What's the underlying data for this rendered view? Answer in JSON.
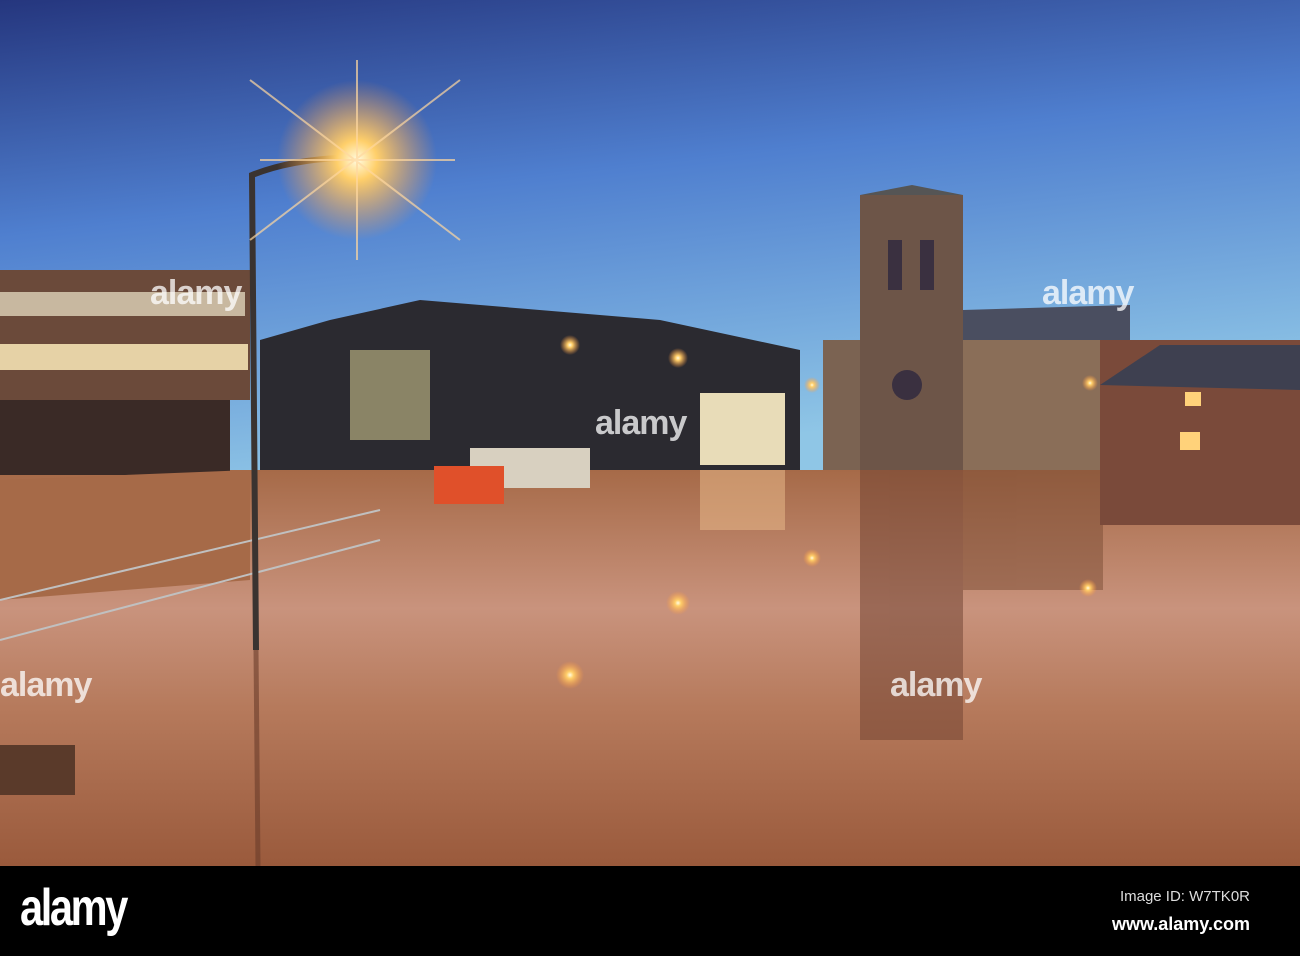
{
  "watermark": {
    "text": "alamy",
    "small_text": "a"
  },
  "footer": {
    "logo": "alamy",
    "image_id": "Image ID: W7TK0R",
    "website": "www.alamy.com"
  },
  "colors": {
    "sky_top": "#2c3f8a",
    "sky_mid": "#4f7fcf",
    "sky_low": "#8cc4e4",
    "water": "#b8714f",
    "lamp": "#ffd27a"
  }
}
